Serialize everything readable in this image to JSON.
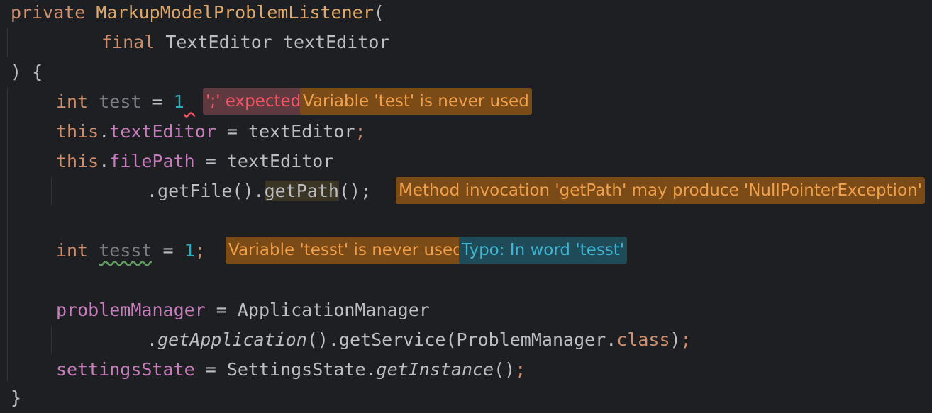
{
  "code": {
    "line1": {
      "kw": "private",
      "name": "MarkupModelProblemListener",
      "paren": "("
    },
    "line2": {
      "kw": "final",
      "type": "TextEditor",
      "param": "textEditor"
    },
    "line3": {
      "text": ") {"
    },
    "line4": {
      "kw": "int",
      "var": "test",
      "eq": " = ",
      "num": "1"
    },
    "line5": {
      "kw": "this",
      "dot": ".",
      "field": "textEditor",
      "rest": " = textEditor",
      "semi": ";"
    },
    "line6": {
      "kw": "this",
      "dot": ".",
      "field": "filePath",
      "rest": " = textEditor"
    },
    "line7": {
      "pre": ".getFile().",
      "call": "getPath",
      "post": "();"
    },
    "line9": {
      "kw": "int",
      "var": "tesst",
      "eq": " = ",
      "num": "1",
      "semi": ";"
    },
    "line11": {
      "field": "problemManager",
      "rest": " = ApplicationManager"
    },
    "line12": {
      "dot": ".",
      "call": "getApplication",
      "mid": "().getService(ProblemManager.",
      "kw": "class",
      "close": ")",
      "semi": ";"
    },
    "line13": {
      "field": "settingsState",
      "rest": " = SettingsState.",
      "call": "getInstance",
      "close": "()",
      "semi": ";"
    },
    "line14": {
      "text": "}"
    }
  },
  "hints": {
    "semicolon_expected": "';' expected",
    "test_unused": "Variable 'test' is never used",
    "npe_warning": "Method invocation 'getPath' may produce 'NullPointerException'",
    "tesst_unused": "Variable 'tesst' is never used",
    "typo": "Typo: In word 'tesst'"
  }
}
